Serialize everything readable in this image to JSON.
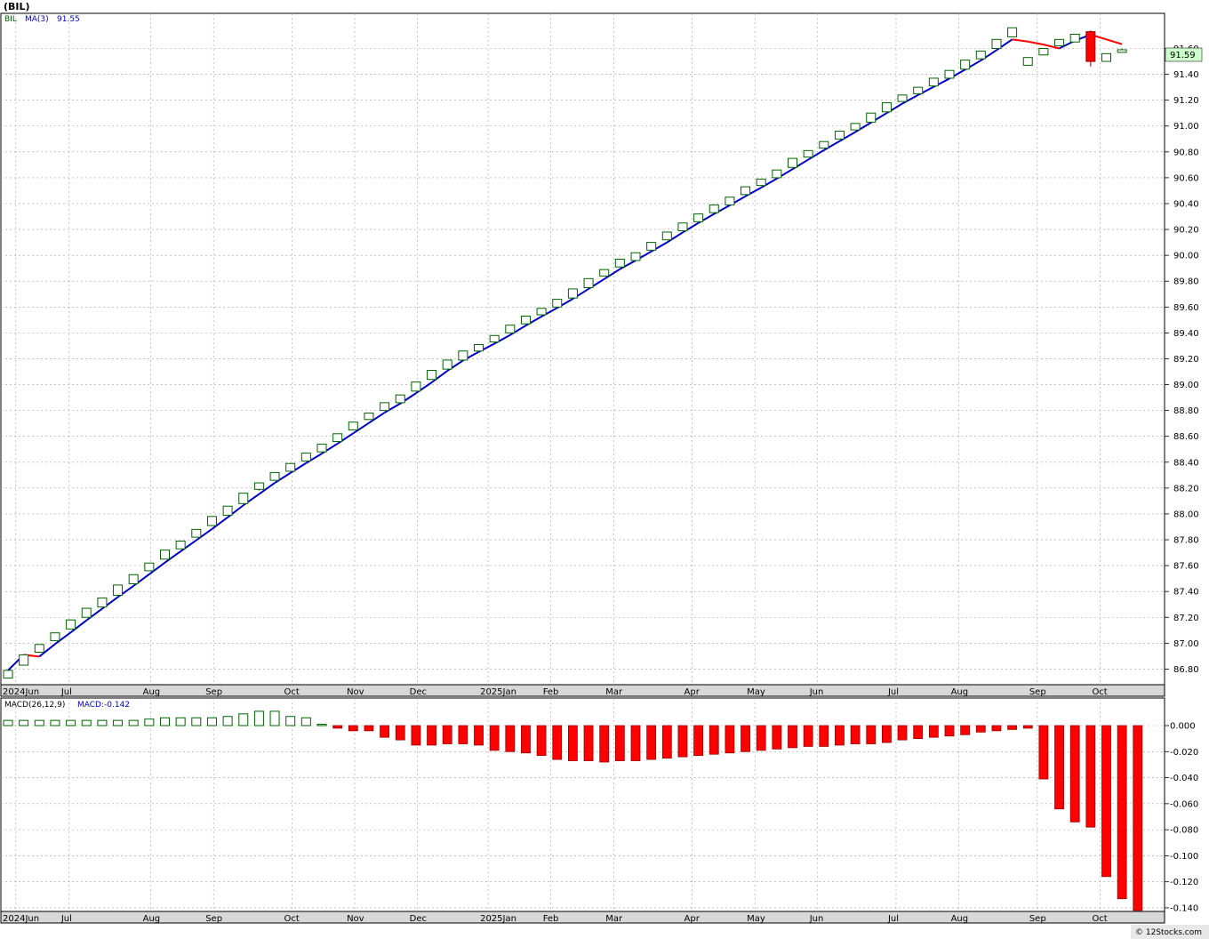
{
  "title": "(BIL)",
  "copyright": "© 12Stocks.com",
  "colors": {
    "up_candle_stroke": "#006400",
    "down_candle": "#ff0000",
    "ma_rising": "#0000cc",
    "ma_falling": "#ff0000",
    "macd_bar_positive_stroke": "#006400",
    "macd_bar_negative": "#ff0000",
    "grid": "#a0a0a0",
    "last_price_bg": "#ccffcc"
  },
  "price_panel": {
    "legend": {
      "symbol": "BIL",
      "ma_label": "MA(3)",
      "ma_value": "91.55"
    },
    "last_price_label": "91.59",
    "y_ticks": [
      "86.80",
      "87.00",
      "87.20",
      "87.40",
      "87.60",
      "87.80",
      "88.00",
      "88.20",
      "88.40",
      "88.60",
      "88.80",
      "89.00",
      "89.20",
      "89.40",
      "89.60",
      "89.80",
      "90.00",
      "90.20",
      "90.40",
      "90.60",
      "90.80",
      "91.00",
      "91.20",
      "91.40",
      "91.60"
    ]
  },
  "macd_panel": {
    "legend": {
      "label": "MACD(26,12,9)",
      "value_label": "MACD:-0.142"
    },
    "y_ticks": [
      "0.000",
      "-0.020",
      "-0.040",
      "-0.060",
      "-0.080",
      "-0.100",
      "-0.120",
      "-0.140"
    ]
  },
  "x_axis": {
    "months": [
      "2024Jun",
      "Jul",
      "Aug",
      "Sep",
      "Oct",
      "Nov",
      "Dec",
      "2025Jan",
      "Feb",
      "Mar",
      "Apr",
      "May",
      "Jun",
      "Jul",
      "Aug",
      "Sep",
      "Oct"
    ]
  },
  "chart_data": [
    {
      "type": "candlestick",
      "title": "(BIL)",
      "frequency": "weekly",
      "ylim": [
        86.7,
        91.9
      ],
      "x_labels": [
        "2024Jun",
        "Jul",
        "Aug",
        "Sep",
        "Oct",
        "Nov",
        "Dec",
        "2025Jan",
        "Feb",
        "Mar",
        "Apr",
        "May",
        "Jun",
        "Jul",
        "Aug",
        "Sep",
        "Oct"
      ],
      "candles": [
        [
          86.73,
          86.79,
          86.73,
          86.79
        ],
        [
          86.83,
          86.91,
          86.83,
          86.91
        ],
        [
          86.93,
          86.99,
          86.93,
          86.99
        ],
        [
          87.02,
          87.08,
          87.02,
          87.08
        ],
        [
          87.11,
          87.18,
          87.11,
          87.18
        ],
        [
          87.2,
          87.27,
          87.2,
          87.27
        ],
        [
          87.28,
          87.35,
          87.28,
          87.35
        ],
        [
          87.37,
          87.45,
          87.37,
          87.45
        ],
        [
          87.46,
          87.53,
          87.46,
          87.53
        ],
        [
          87.56,
          87.62,
          87.56,
          87.62
        ],
        [
          87.65,
          87.72,
          87.65,
          87.72
        ],
        [
          87.73,
          87.79,
          87.73,
          87.79
        ],
        [
          87.82,
          87.88,
          87.82,
          87.88
        ],
        [
          87.91,
          87.98,
          87.91,
          87.98
        ],
        [
          87.99,
          88.06,
          87.99,
          88.06
        ],
        [
          88.08,
          88.16,
          88.08,
          88.16
        ],
        [
          88.19,
          88.24,
          88.18,
          88.24
        ],
        [
          88.26,
          88.32,
          88.26,
          88.32
        ],
        [
          88.33,
          88.39,
          88.33,
          88.39
        ],
        [
          88.41,
          88.47,
          88.41,
          88.47
        ],
        [
          88.48,
          88.54,
          88.48,
          88.54
        ],
        [
          88.56,
          88.62,
          88.56,
          88.62
        ],
        [
          88.65,
          88.71,
          88.65,
          88.71
        ],
        [
          88.73,
          88.78,
          88.73,
          88.78
        ],
        [
          88.8,
          88.86,
          88.8,
          88.86
        ],
        [
          88.86,
          88.92,
          88.86,
          88.92
        ],
        [
          88.95,
          89.02,
          88.95,
          89.02
        ],
        [
          89.04,
          89.11,
          89.04,
          89.11
        ],
        [
          89.12,
          89.19,
          89.12,
          89.19
        ],
        [
          89.19,
          89.26,
          89.19,
          89.26
        ],
        [
          89.26,
          89.31,
          89.26,
          89.31
        ],
        [
          89.33,
          89.38,
          89.32,
          89.38
        ],
        [
          89.4,
          89.46,
          89.4,
          89.46
        ],
        [
          89.47,
          89.53,
          89.47,
          89.53
        ],
        [
          89.54,
          89.59,
          89.54,
          89.59
        ],
        [
          89.6,
          89.66,
          89.6,
          89.66
        ],
        [
          89.67,
          89.74,
          89.67,
          89.74
        ],
        [
          89.75,
          89.82,
          89.75,
          89.82
        ],
        [
          89.84,
          89.89,
          89.84,
          89.89
        ],
        [
          89.91,
          89.97,
          89.91,
          89.97
        ],
        [
          89.96,
          90.02,
          89.96,
          90.02
        ],
        [
          90.04,
          90.1,
          90.04,
          90.1
        ],
        [
          90.12,
          90.18,
          90.12,
          90.18
        ],
        [
          90.19,
          90.25,
          90.19,
          90.25
        ],
        [
          90.26,
          90.32,
          90.26,
          90.32
        ],
        [
          90.33,
          90.39,
          90.33,
          90.39
        ],
        [
          90.39,
          90.45,
          90.39,
          90.45
        ],
        [
          90.47,
          90.53,
          90.47,
          90.53
        ],
        [
          90.54,
          90.59,
          90.54,
          90.59
        ],
        [
          90.6,
          90.66,
          90.6,
          90.66
        ],
        [
          90.68,
          90.75,
          90.68,
          90.75
        ],
        [
          90.76,
          90.81,
          90.76,
          90.81
        ],
        [
          90.83,
          90.88,
          90.83,
          90.88
        ],
        [
          90.9,
          90.96,
          90.9,
          90.96
        ],
        [
          90.97,
          91.02,
          90.97,
          91.02
        ],
        [
          91.03,
          91.1,
          91.03,
          91.1
        ],
        [
          91.11,
          91.18,
          91.11,
          91.18
        ],
        [
          91.19,
          91.24,
          91.19,
          91.24
        ],
        [
          91.25,
          91.3,
          91.25,
          91.3
        ],
        [
          91.31,
          91.37,
          91.31,
          91.37
        ],
        [
          91.37,
          91.43,
          91.37,
          91.43
        ],
        [
          91.44,
          91.51,
          91.44,
          91.51
        ],
        [
          91.52,
          91.58,
          91.52,
          91.58
        ],
        [
          91.6,
          91.67,
          91.6,
          91.67
        ],
        [
          91.69,
          91.76,
          91.69,
          91.76
        ],
        [
          91.47,
          91.53,
          91.47,
          91.53
        ],
        [
          91.55,
          91.6,
          91.55,
          91.6
        ],
        [
          91.62,
          91.67,
          91.62,
          91.67
        ],
        [
          91.65,
          91.71,
          91.65,
          91.71
        ],
        [
          91.73,
          91.5,
          91.46,
          91.74
        ],
        [
          91.5,
          91.56,
          91.5,
          91.56
        ],
        [
          91.57,
          91.59,
          91.57,
          91.6
        ]
      ],
      "ma_period": 3,
      "ma_last": 91.55
    },
    {
      "type": "bar",
      "title": "MACD(26,12,9)",
      "ylim": [
        -0.142,
        0.012
      ],
      "values": [
        0.004,
        0.004,
        0.004,
        0.004,
        0.004,
        0.004,
        0.004,
        0.004,
        0.004,
        0.005,
        0.006,
        0.006,
        0.006,
        0.006,
        0.007,
        0.009,
        0.011,
        0.011,
        0.007,
        0.006,
        0.001,
        -0.002,
        -0.004,
        -0.004,
        -0.009,
        -0.011,
        -0.015,
        -0.015,
        -0.014,
        -0.014,
        -0.015,
        -0.019,
        -0.02,
        -0.021,
        -0.023,
        -0.026,
        -0.027,
        -0.027,
        -0.028,
        -0.027,
        -0.027,
        -0.026,
        -0.025,
        -0.024,
        -0.023,
        -0.022,
        -0.021,
        -0.02,
        -0.019,
        -0.018,
        -0.017,
        -0.016,
        -0.016,
        -0.015,
        -0.014,
        -0.014,
        -0.013,
        -0.011,
        -0.01,
        -0.009,
        -0.008,
        -0.007,
        -0.005,
        -0.004,
        -0.003,
        -0.002,
        -0.041,
        -0.064,
        -0.074,
        -0.078,
        -0.116,
        -0.133,
        -0.142
      ],
      "value_label": "MACD:-0.142"
    }
  ]
}
